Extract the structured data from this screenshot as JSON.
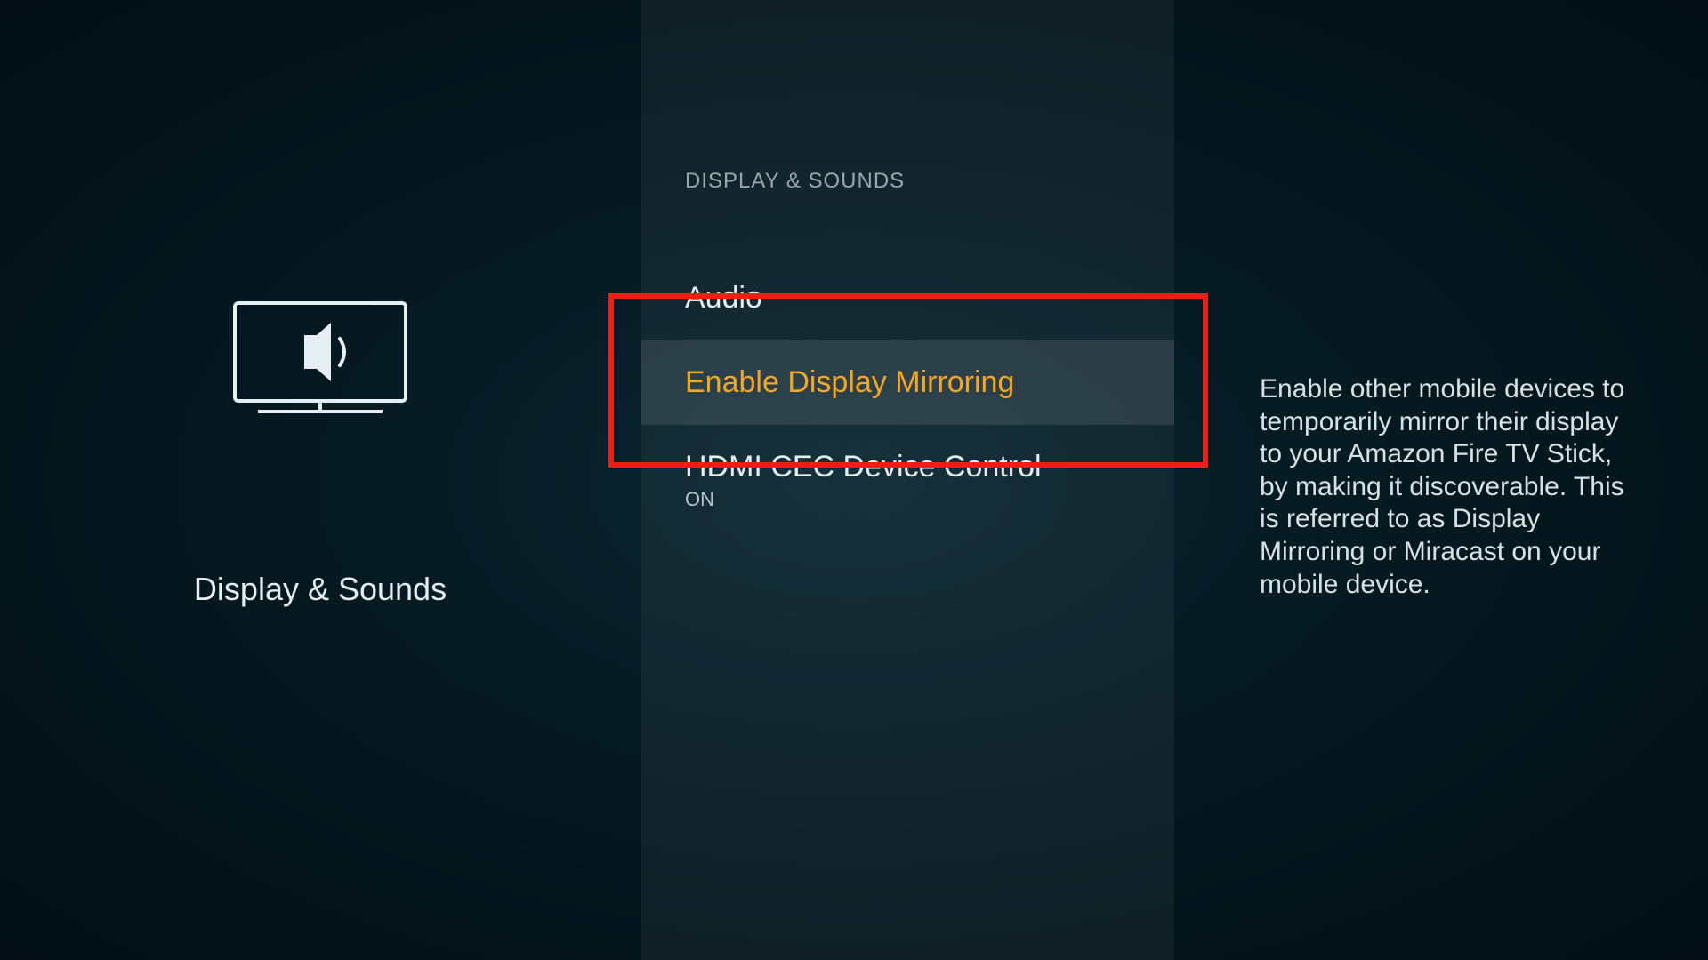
{
  "left": {
    "title": "Display & Sounds"
  },
  "center": {
    "header": "DISPLAY & SOUNDS",
    "items": [
      {
        "label": "Audio",
        "sub": "",
        "selected": false
      },
      {
        "label": "Enable Display Mirroring",
        "sub": "",
        "selected": true
      },
      {
        "label": "HDMI CEC Device Control",
        "sub": "ON",
        "selected": false
      }
    ]
  },
  "right": {
    "description": "Enable other mobile devices to temporarily mirror their display to your Amazon Fire TV Stick, by making it discoverable. This is referred to as Display Mirroring or Miracast on your mobile device."
  },
  "annotation": {
    "highlight_target": "enable-display-mirroring"
  },
  "colors": {
    "accent": "#f5a623",
    "highlight_border": "#e62117"
  }
}
